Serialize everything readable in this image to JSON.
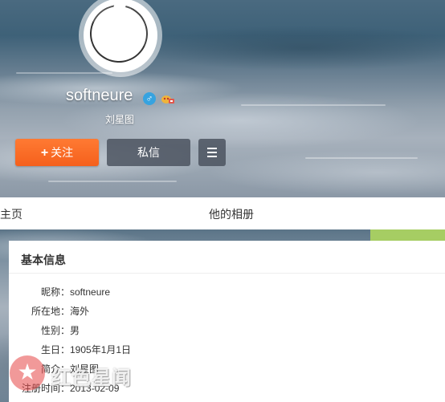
{
  "profile": {
    "username": "softneure",
    "gender_symbol": "♂",
    "vip_icon": "vip-badge-icon",
    "tag": "刘星图"
  },
  "actions": {
    "follow_plus": "+",
    "follow_label": "关注",
    "message_label": "私信",
    "more_icon": "menu-icon"
  },
  "tabs": {
    "home": "的主页",
    "album": "他的相册"
  },
  "info": {
    "title": "基本信息",
    "rows": [
      {
        "key": "昵称",
        "value": "softneure"
      },
      {
        "key": "所在地",
        "value": "海外"
      },
      {
        "key": "性别",
        "value": "男"
      },
      {
        "key": "生日",
        "value": "1905年1月1日"
      },
      {
        "key": "简介",
        "value": "刘星图"
      },
      {
        "key": "注册时间",
        "value": "2013-02-09"
      }
    ],
    "colon": "："
  },
  "watermark": {
    "text": "红色星闻",
    "star": "★"
  },
  "colors": {
    "follow": "#f5601c",
    "dark_button": "#464e5a",
    "green_strip": "#a6cd63",
    "gender_blue": "#36a3e0"
  }
}
